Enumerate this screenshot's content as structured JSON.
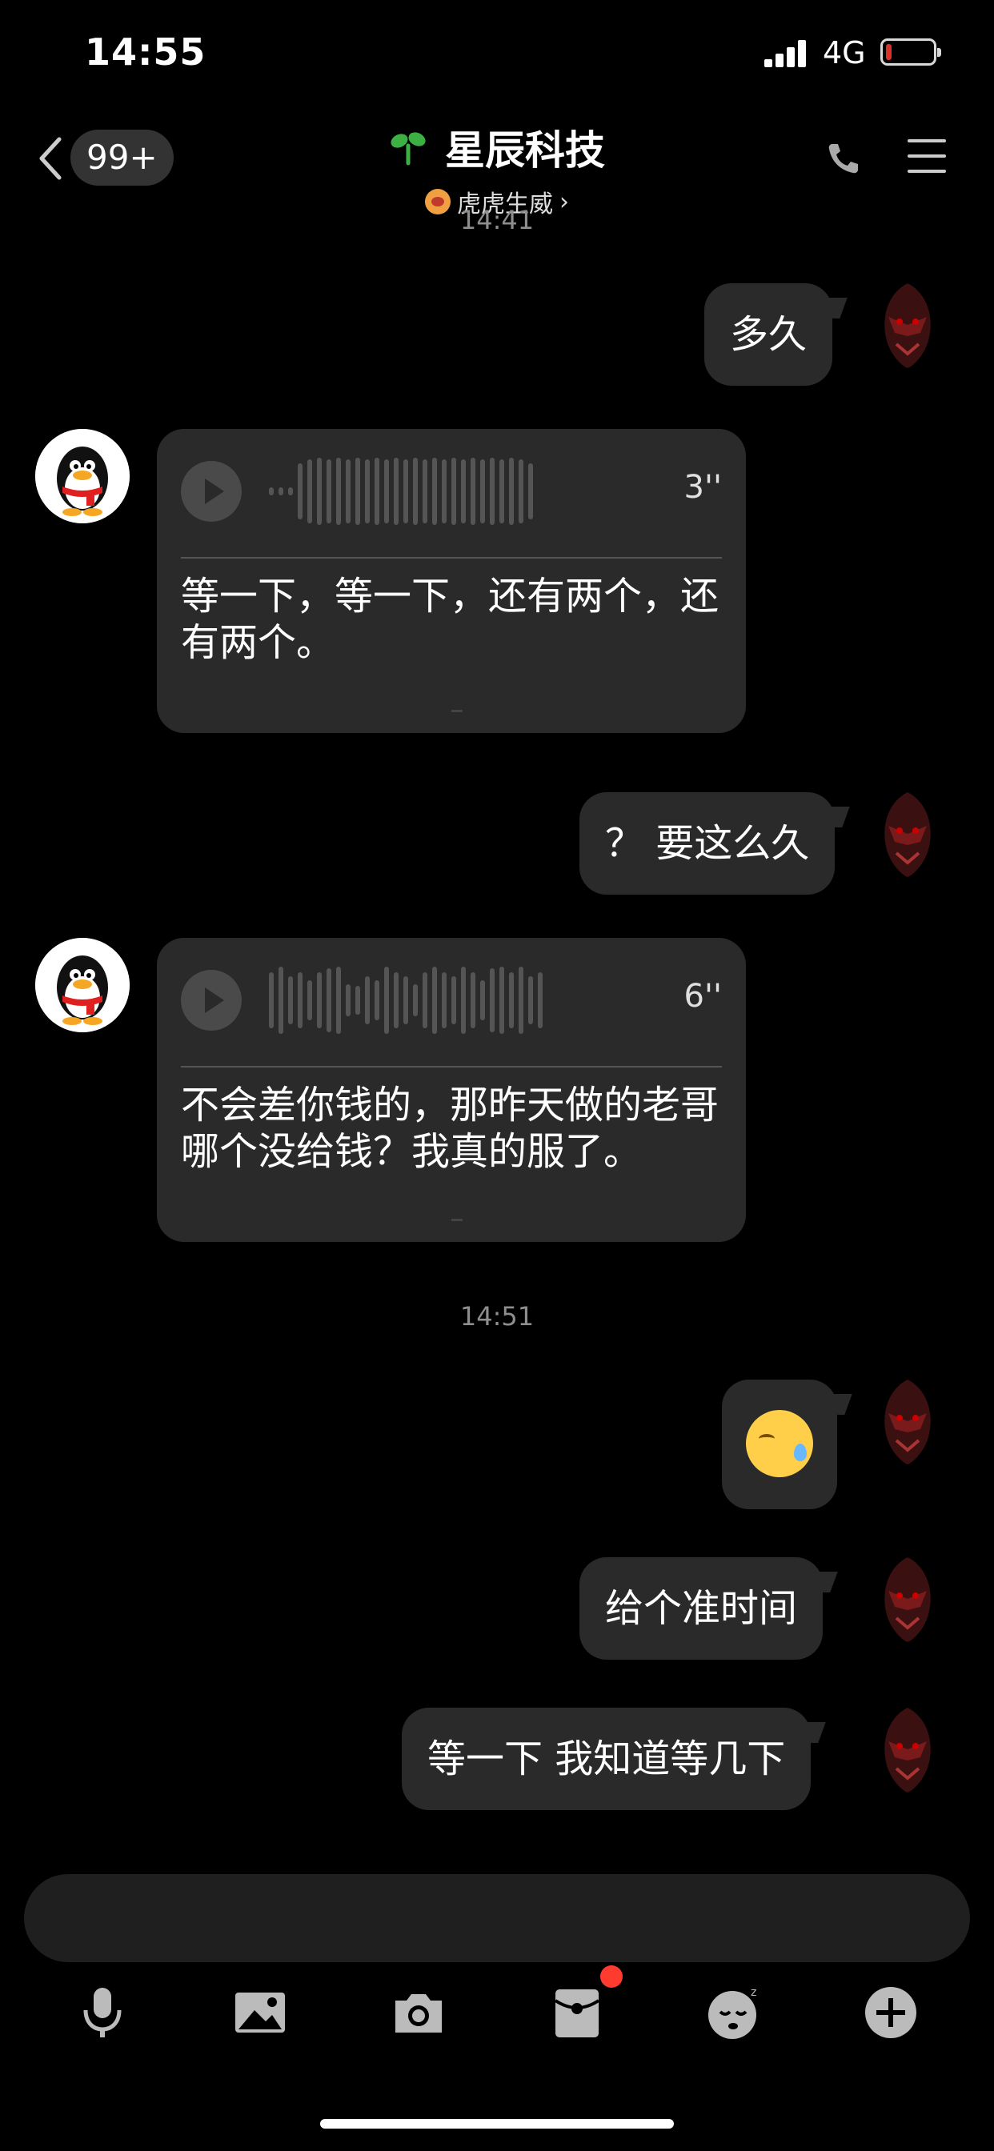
{
  "status_bar": {
    "time": "14:55",
    "network": "4G",
    "battery_level": 0.08
  },
  "nav": {
    "unread_badge": "99+",
    "title": "星辰科技",
    "subtitle": "虎虎生威",
    "icons": [
      "back-chevron-icon",
      "sprout-icon",
      "tiger-icon",
      "phone-icon",
      "menu-icon"
    ]
  },
  "messages": [
    {
      "type": "timestamp",
      "text": "14:41"
    },
    {
      "type": "text",
      "from": "me",
      "text": "多久"
    },
    {
      "type": "voice",
      "from": "other",
      "duration": "3''",
      "transcript": "等一下，等一下，还有两个，还有两个。"
    },
    {
      "type": "text",
      "from": "me",
      "text": "？ 要这么久"
    },
    {
      "type": "voice",
      "from": "other",
      "duration": "6''",
      "transcript": "不会差你钱的，那昨天做的老哥哪个没给钱？我真的服了。"
    },
    {
      "type": "timestamp",
      "text": "14:51"
    },
    {
      "type": "sticker",
      "from": "me",
      "icon": "sweat-emoji-icon"
    },
    {
      "type": "text",
      "from": "me",
      "text": "给个准时间"
    },
    {
      "type": "text",
      "from": "me",
      "text": "等一下 我知道等几下"
    }
  ],
  "toolbar": {
    "items": [
      "microphone-icon",
      "image-icon",
      "camera-icon",
      "red-packet-icon",
      "sleepy-emoji-icon",
      "plus-icon"
    ]
  },
  "colors": {
    "background": "#000000",
    "bubble": "#2a2a2a",
    "badge": "#333333",
    "alert": "#ff3b30",
    "sprout": "#3cb043"
  }
}
